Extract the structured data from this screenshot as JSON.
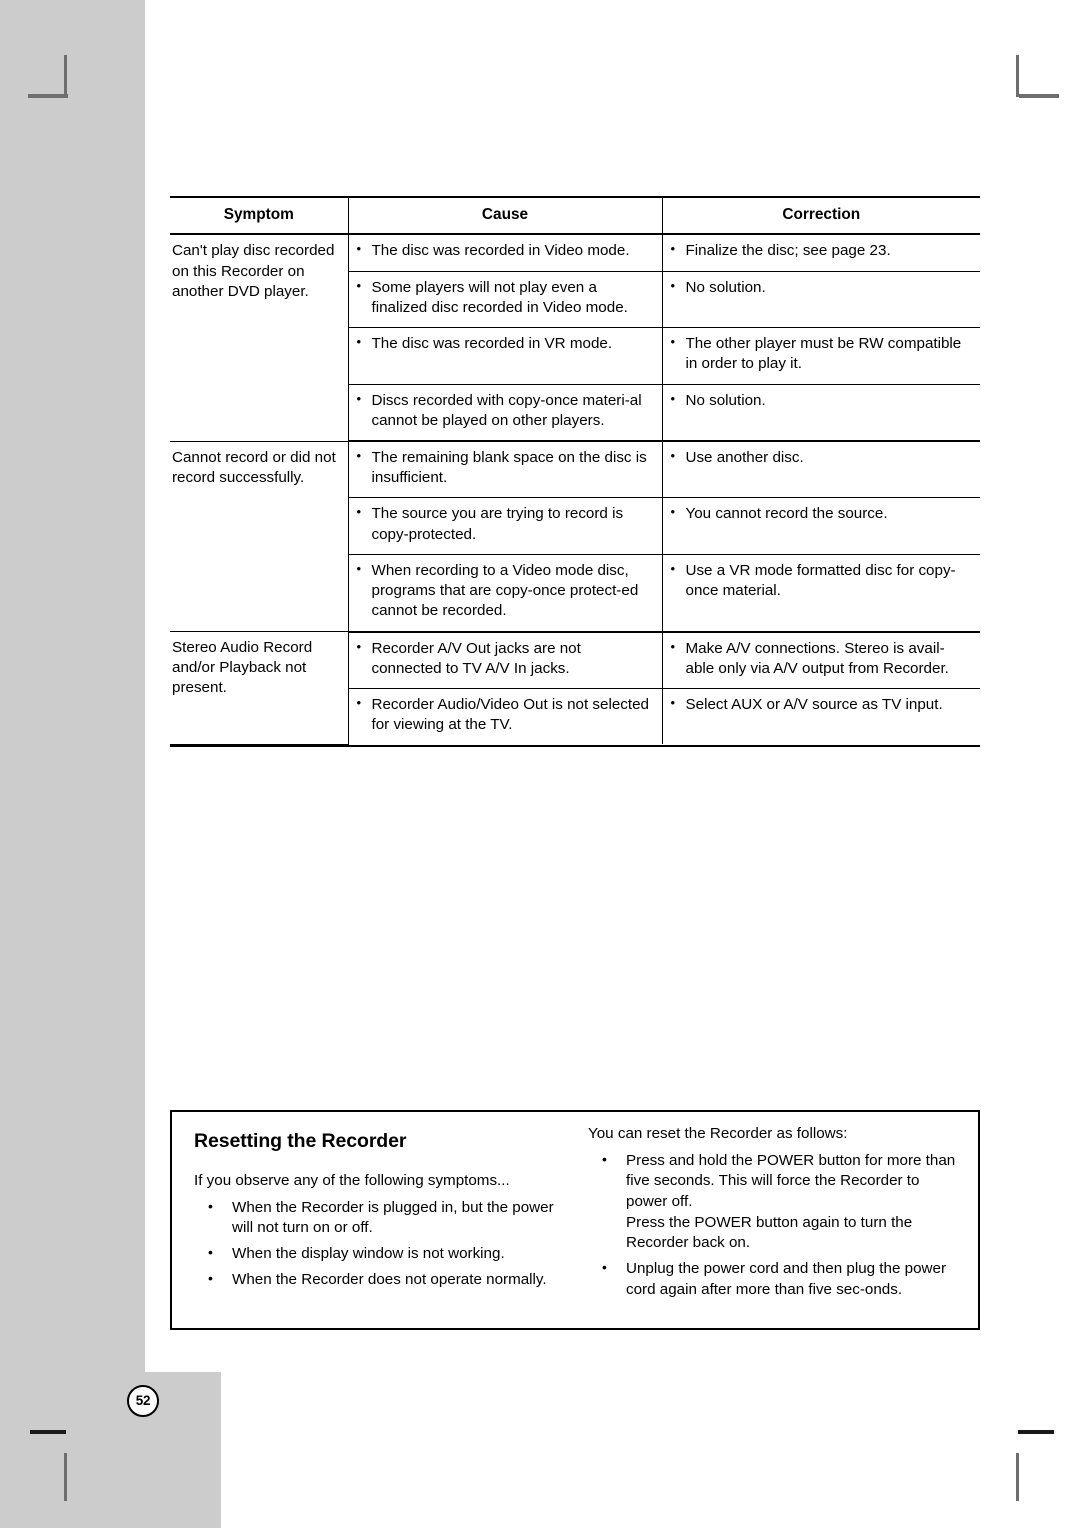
{
  "page": {
    "number": "52",
    "background_gray": "#cccccc",
    "page_white": "#ffffff",
    "ink": "#000000"
  },
  "table": {
    "headers": [
      "Symptom",
      "Cause",
      "Correction"
    ],
    "groups": [
      {
        "symptom": "Can't play disc recorded on this Recorder on another DVD player.",
        "rows": [
          {
            "cause": [
              "The disc was recorded in Video mode."
            ],
            "correction": [
              "Finalize the disc; see page 23."
            ]
          },
          {
            "cause": [
              "Some players will not play even a finalized disc recorded in Video mode."
            ],
            "correction": [
              "No solution."
            ]
          },
          {
            "cause": [
              "The disc was recorded in VR mode."
            ],
            "correction": [
              "The other player must be RW compatible in order to play it."
            ]
          },
          {
            "cause": [
              "Discs recorded with copy-once materi-al cannot be played on other players."
            ],
            "correction": [
              "No solution."
            ]
          }
        ]
      },
      {
        "symptom": "Cannot record or did not record successfully.",
        "rows": [
          {
            "cause": [
              "The remaining blank space on the disc is insufficient."
            ],
            "correction": [
              "Use another disc."
            ]
          },
          {
            "cause": [
              "The source you are trying to record is copy-protected."
            ],
            "correction": [
              "You cannot record the source."
            ]
          },
          {
            "cause": [
              "When recording to a Video mode disc, programs that are copy-once protect-ed cannot be recorded."
            ],
            "correction": [
              "Use a VR mode formatted disc for copy-once material."
            ]
          }
        ]
      },
      {
        "symptom": "Stereo Audio Record and/or Playback not present.",
        "rows": [
          {
            "cause": [
              "Recorder A/V Out jacks are not connected to TV A/V In jacks."
            ],
            "correction": [
              "Make A/V connections. Stereo is avail-able only via A/V output from Recorder."
            ]
          },
          {
            "cause": [
              "Recorder Audio/Video Out is not selected for viewing at the TV."
            ],
            "correction": [
              "Select AUX or A/V source as TV input."
            ]
          }
        ]
      }
    ]
  },
  "reset_box": {
    "title": "Resetting the Recorder",
    "left_lead": "If you observe any of the following symptoms...",
    "left_items": [
      "When the Recorder is plugged in, but the power will not turn on or off.",
      "When the display window is not working.",
      "When the Recorder does not operate normally."
    ],
    "right_lead": "You can reset the Recorder as follows:",
    "right_items": [
      {
        "text": "Press and hold the POWER button for more than five seconds. This will force the Recorder to power off.",
        "continuation": "Press the POWER button again to turn the Recorder back on."
      },
      {
        "text": "Unplug the power cord and then plug the power cord again after more than five sec-onds.",
        "continuation": ""
      }
    ]
  }
}
